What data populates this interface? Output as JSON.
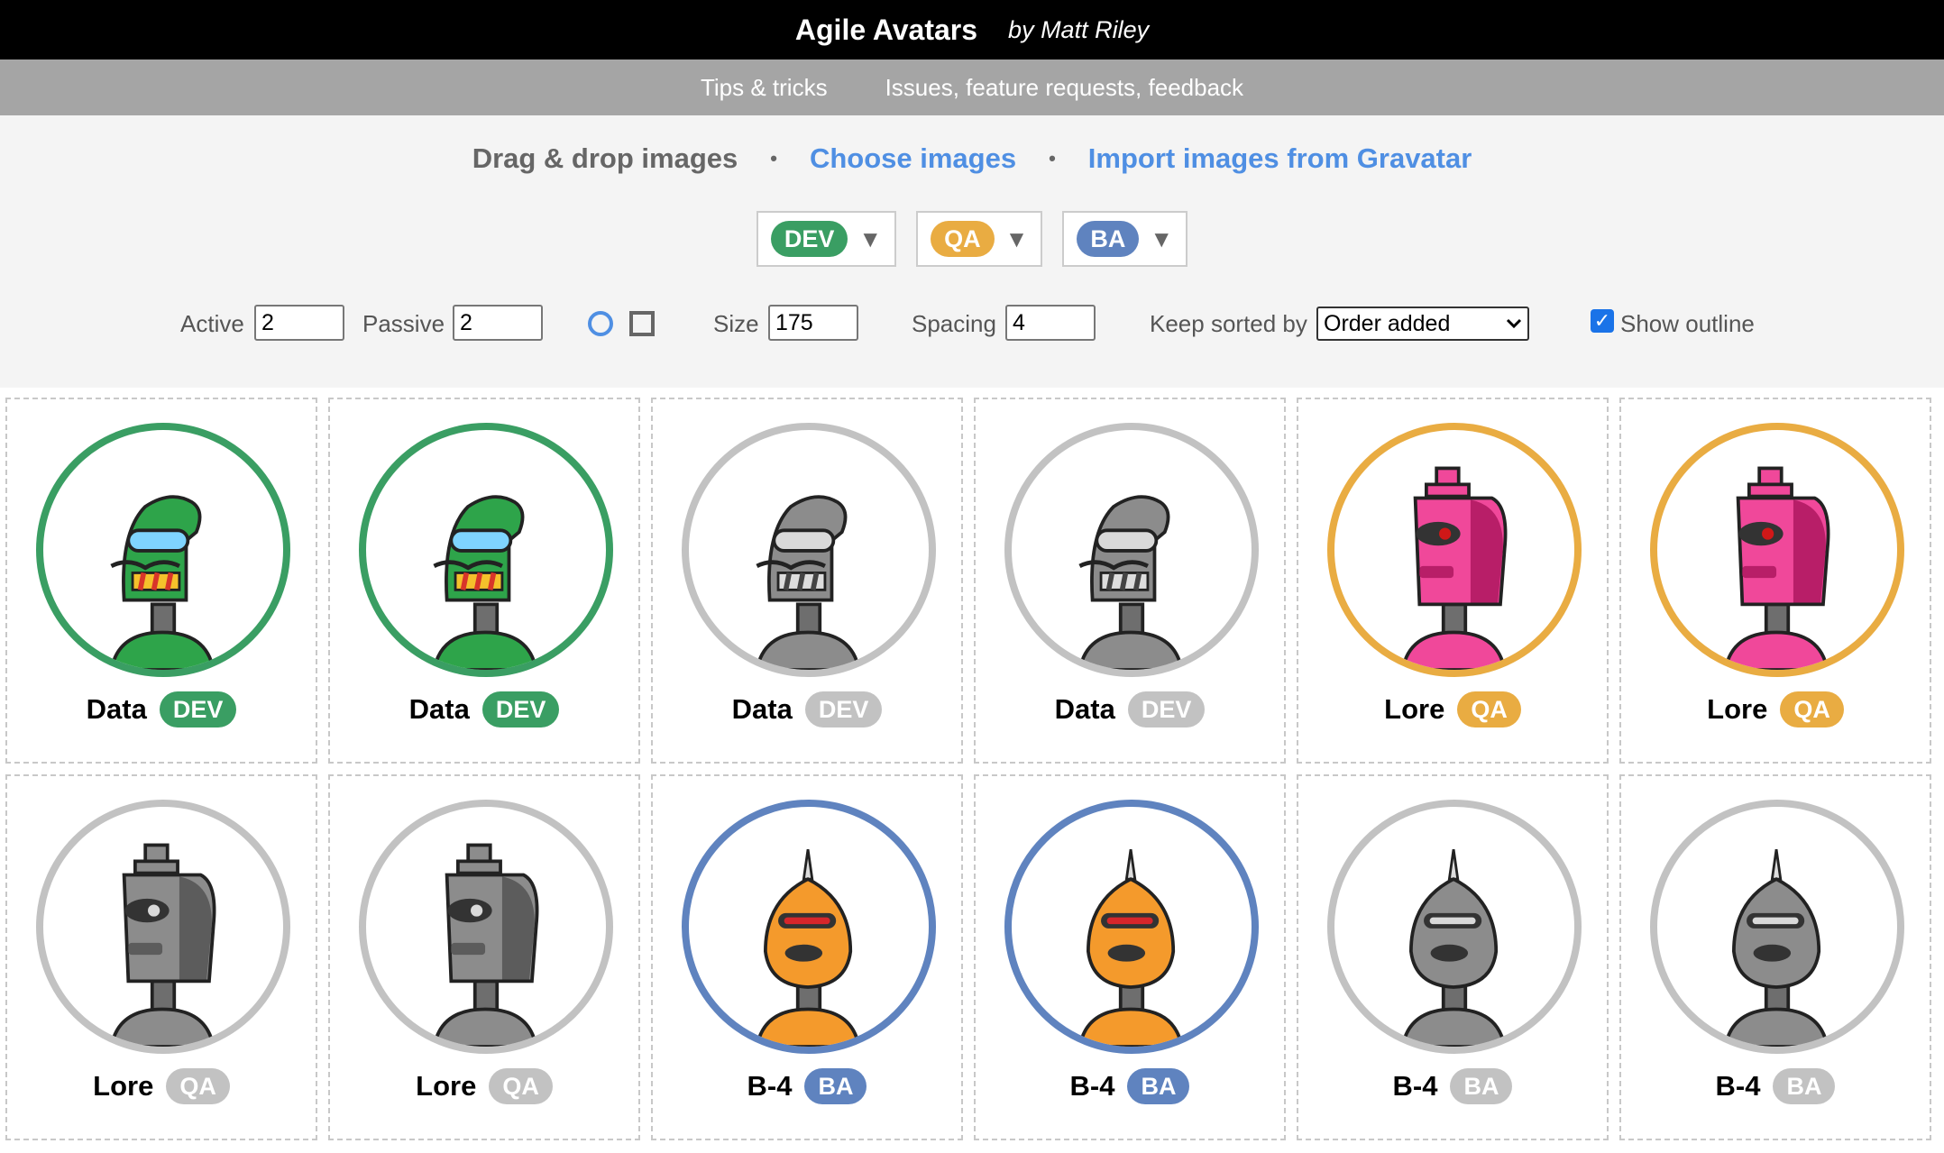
{
  "header": {
    "title": "Agile Avatars",
    "byline": "by Matt Riley"
  },
  "nav": {
    "tips": "Tips & tricks",
    "issues": "Issues, feature requests, feedback"
  },
  "import": {
    "drag": "Drag & drop images",
    "bullet": "•",
    "choose": "Choose images",
    "gravatar": "Import images from Gravatar"
  },
  "roles": [
    {
      "label": "DEV",
      "color": "#3a9e63"
    },
    {
      "label": "QA",
      "color": "#e9ac42"
    },
    {
      "label": "BA",
      "color": "#5f83bf"
    }
  ],
  "role_dropdown_arrow": "▼",
  "settings": {
    "active_label": "Active",
    "active_value": "2",
    "passive_label": "Passive",
    "passive_value": "2",
    "size_label": "Size",
    "size_value": "175",
    "spacing_label": "Spacing",
    "spacing_value": "4",
    "sort_label": "Keep sorted by",
    "sort_value": "Order added",
    "outline_label": "Show outline",
    "outline_checked": true
  },
  "colors": {
    "inactive": "#c2c2c2",
    "link": "#4f8fe3"
  },
  "avatars": [
    {
      "name": "Data",
      "role": "DEV",
      "active": true,
      "robot": "data"
    },
    {
      "name": "Data",
      "role": "DEV",
      "active": true,
      "robot": "data"
    },
    {
      "name": "Data",
      "role": "DEV",
      "active": false,
      "robot": "data"
    },
    {
      "name": "Data",
      "role": "DEV",
      "active": false,
      "robot": "data"
    },
    {
      "name": "Lore",
      "role": "QA",
      "active": true,
      "robot": "lore"
    },
    {
      "name": "Lore",
      "role": "QA",
      "active": true,
      "robot": "lore"
    },
    {
      "name": "Lore",
      "role": "QA",
      "active": false,
      "robot": "lore"
    },
    {
      "name": "Lore",
      "role": "QA",
      "active": false,
      "robot": "lore"
    },
    {
      "name": "B-4",
      "role": "BA",
      "active": true,
      "robot": "b4"
    },
    {
      "name": "B-4",
      "role": "BA",
      "active": true,
      "robot": "b4"
    },
    {
      "name": "B-4",
      "role": "BA",
      "active": false,
      "robot": "b4"
    },
    {
      "name": "B-4",
      "role": "BA",
      "active": false,
      "robot": "b4"
    }
  ]
}
